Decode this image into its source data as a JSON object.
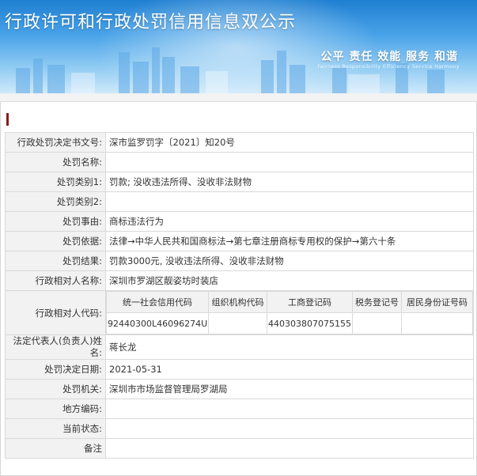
{
  "header": {
    "title": "行政许可和行政处罚信用信息双公示",
    "motto": "公平  责任  效能  服务  和谐",
    "motto_en": "Fairness  Responsibility  Efficiency  Service  Harmony"
  },
  "record": {
    "rows_top": [
      {
        "label": "行政处罚决定书文号:",
        "value": "深市监罗罚字〔2021〕知20号"
      },
      {
        "label": "处罚名称:",
        "value": ""
      },
      {
        "label": "处罚类别1:",
        "value": "罚款; 没收违法所得、没收非法财物"
      },
      {
        "label": "处罚类别2:",
        "value": ""
      },
      {
        "label": "处罚事由:",
        "value": "商标违法行为"
      },
      {
        "label": "处罚依据:",
        "value": "法律→中华人民共和国商标法→第七章注册商标专用权的保护→第六十条"
      },
      {
        "label": "处罚结果:",
        "value": "罚款3000元, 没收违法所得、没收非法财物"
      },
      {
        "label": "行政相对人名称:",
        "value": "深圳市罗湖区靓姿坊时装店"
      }
    ],
    "codes": {
      "label": "行政相对人代码:",
      "headers": [
        "统一社会信用代码",
        "组织机构代码",
        "工商登记码",
        "税务登记号",
        "居民身份证号码"
      ],
      "values": [
        "92440300L46096274U",
        "",
        "440303807075155",
        "",
        ""
      ]
    },
    "legal_rep": {
      "label": "法定代表人(负责人)姓名:",
      "value": "蒋长龙"
    },
    "rows_bottom": [
      {
        "label": "处罚决定日期:",
        "value": "2021-05-31"
      },
      {
        "label": "处罚机关:",
        "value": "深圳市市场监督管理局罗湖局"
      },
      {
        "label": "地方编码:",
        "value": ""
      },
      {
        "label": "当前状态:",
        "value": ""
      },
      {
        "label": "备注",
        "value": ""
      }
    ]
  }
}
